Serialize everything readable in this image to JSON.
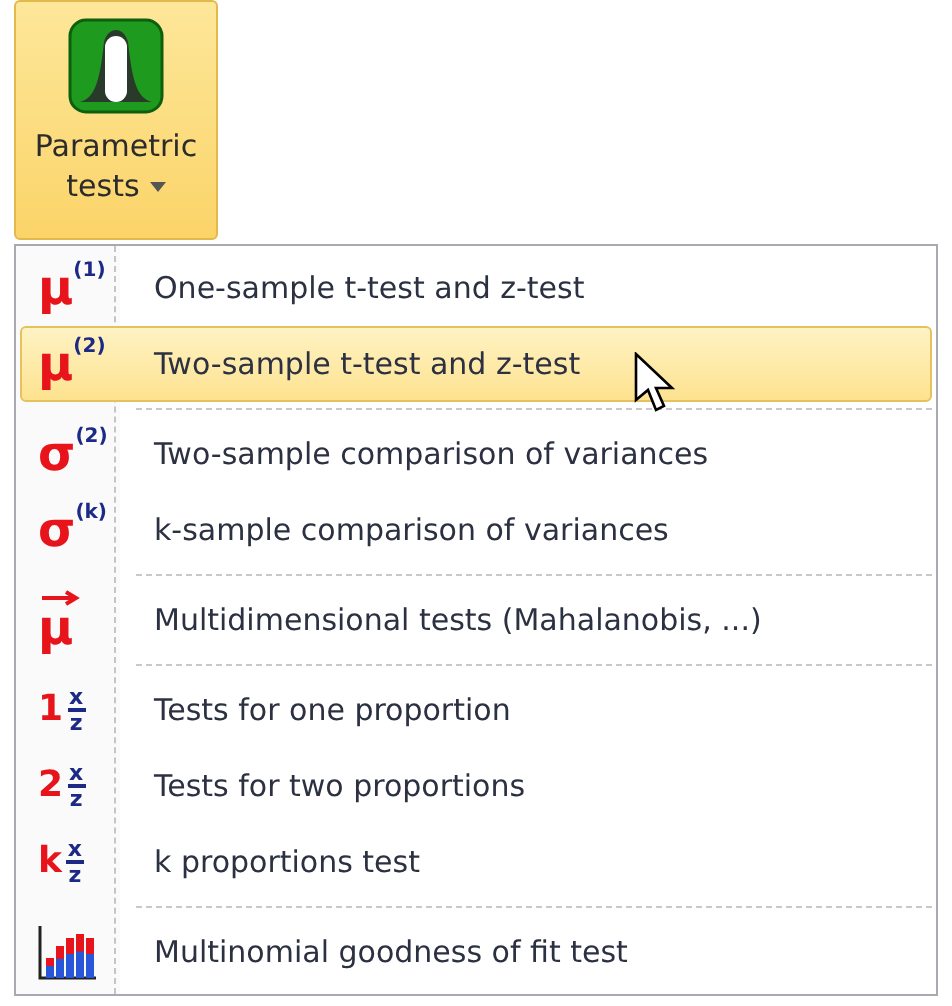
{
  "ribbon_button": {
    "label_lines": [
      "Parametric",
      "tests"
    ],
    "selected": true
  },
  "menu": {
    "groups": [
      [
        {
          "kind": "greek",
          "symbol": "μ",
          "index": "(1)",
          "label": "One-sample t-test and z-test",
          "selected": false
        },
        {
          "kind": "greek",
          "symbol": "μ",
          "index": "(2)",
          "label": "Two-sample t-test and z-test",
          "selected": true
        }
      ],
      [
        {
          "kind": "greek",
          "symbol": "σ",
          "index": "(2)",
          "label": "Two-sample comparison of variances",
          "selected": false
        },
        {
          "kind": "greek",
          "symbol": "σ",
          "index": "(k)",
          "label": "k-sample comparison of variances",
          "selected": false
        }
      ],
      [
        {
          "kind": "vector",
          "symbol": "μ",
          "label": "Multidimensional tests (Mahalanobis, ...)",
          "selected": false
        }
      ],
      [
        {
          "kind": "proportion",
          "symbol": "1",
          "numerator": "x",
          "denominator": "z",
          "label": "Tests for one proportion",
          "selected": false
        },
        {
          "kind": "proportion",
          "symbol": "2",
          "numerator": "x",
          "denominator": "z",
          "label": "Tests for two proportions",
          "selected": false
        },
        {
          "kind": "proportion",
          "symbol": "k",
          "numerator": "x",
          "denominator": "z",
          "label": "k proportions test",
          "selected": false
        }
      ],
      [
        {
          "kind": "chart",
          "label": "Multinomial goodness of fit test",
          "selected": false
        }
      ]
    ]
  }
}
